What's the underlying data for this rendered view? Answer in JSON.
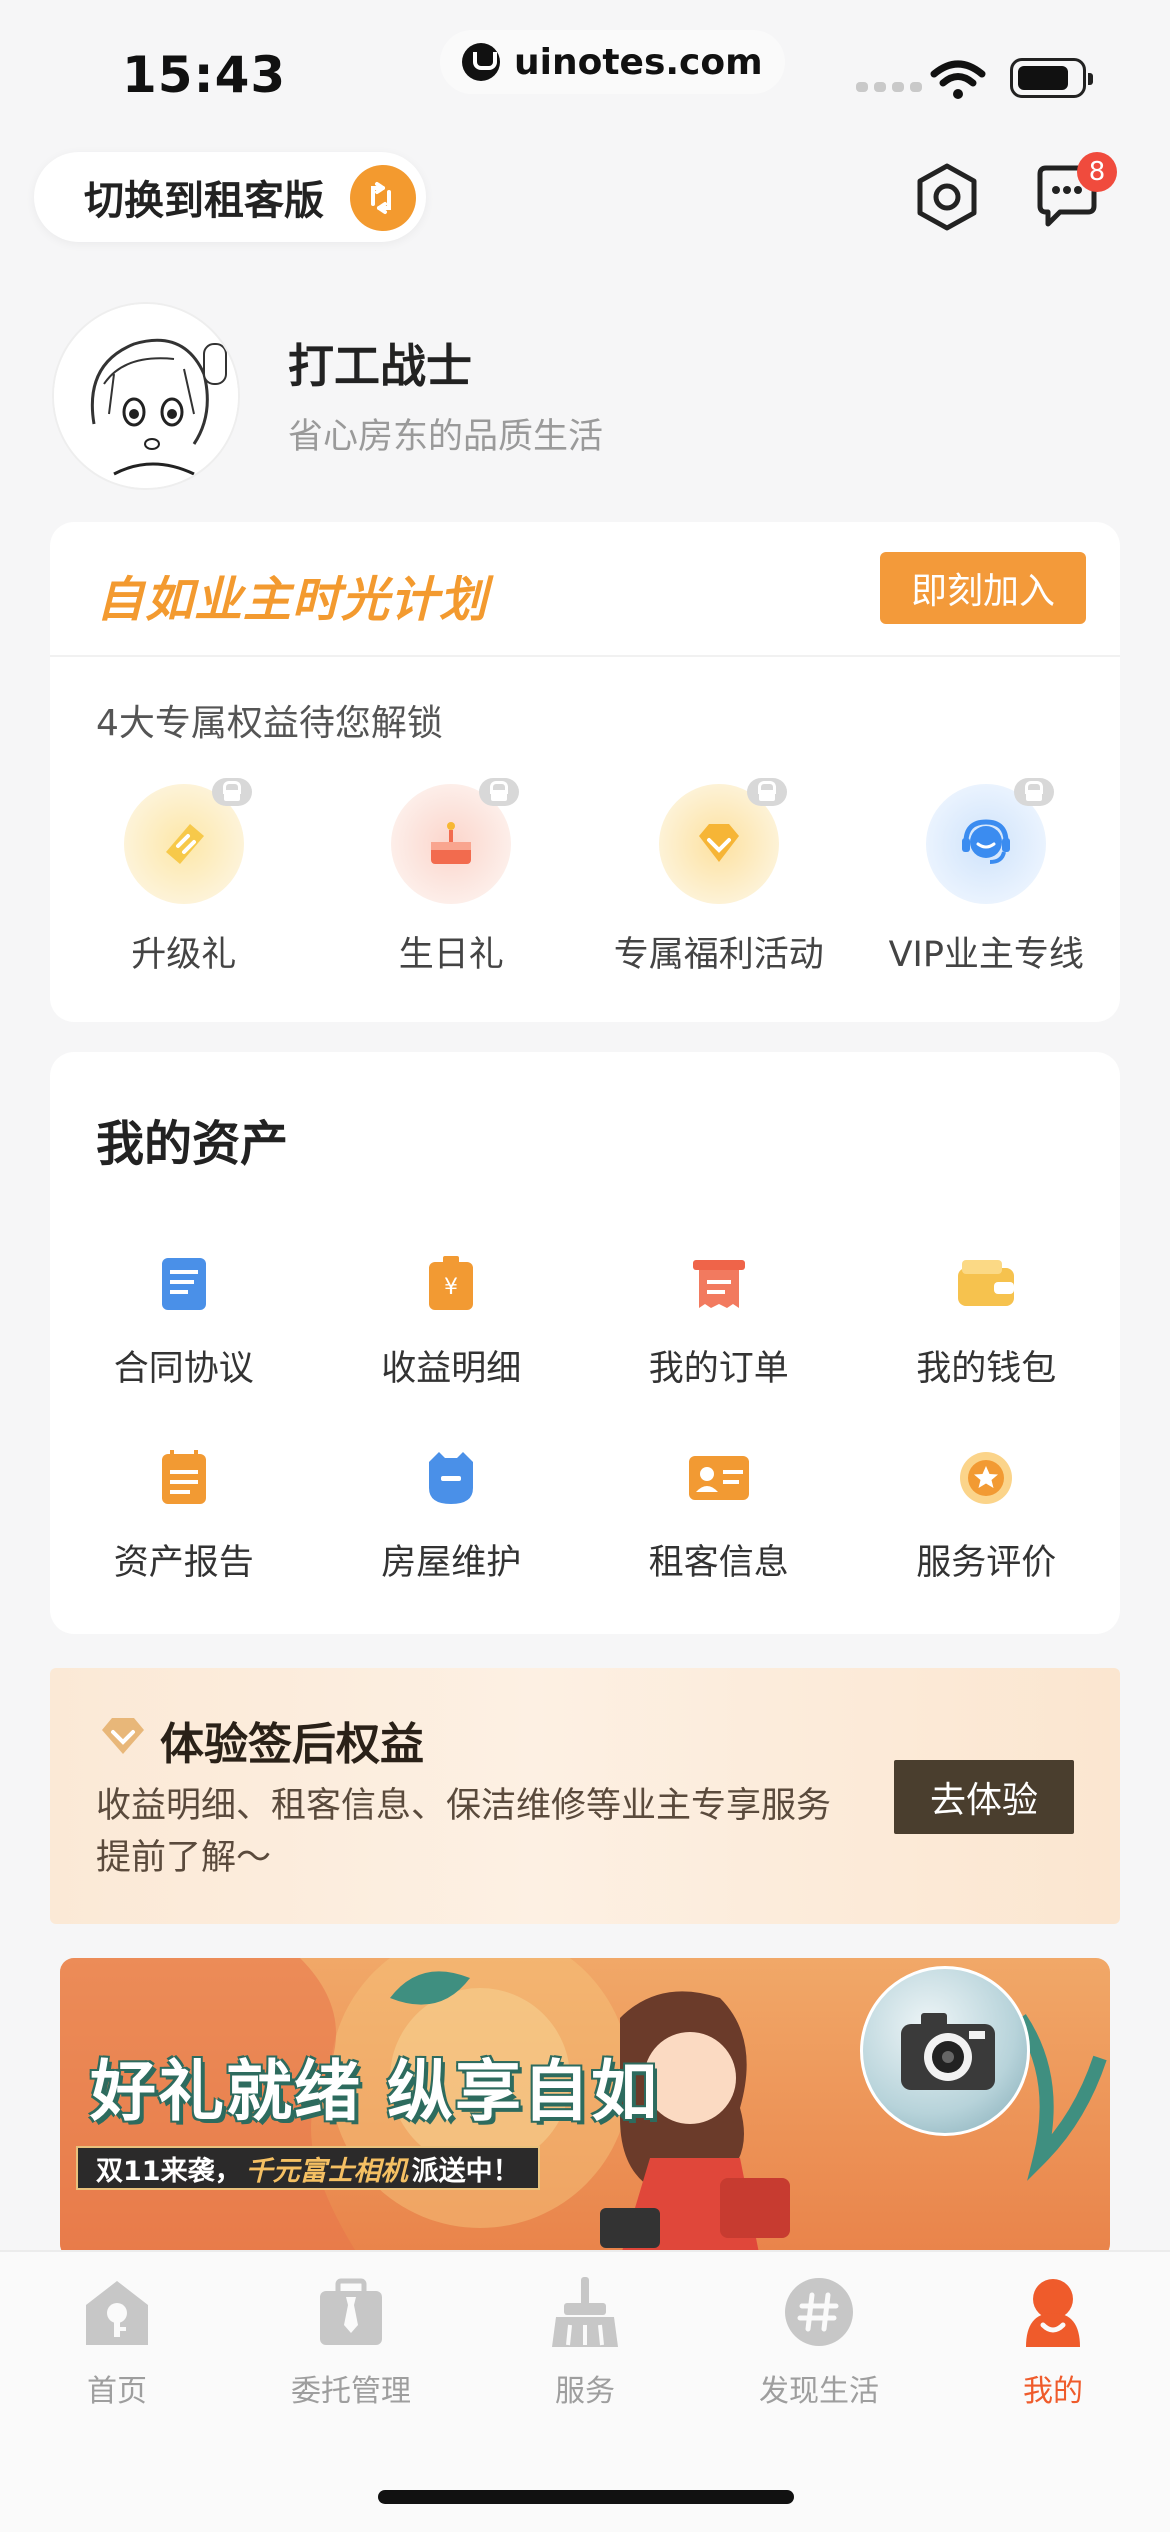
{
  "status": {
    "time": "15:43",
    "url": "uinotes.com"
  },
  "header": {
    "switch_label": "切换到租客版",
    "message_badge": "8"
  },
  "profile": {
    "name": "打工战士",
    "slogan": "省心房东的品质生活"
  },
  "plan": {
    "title": "自如业主时光计划",
    "join_label": "即刻加入",
    "subtitle": "4大专属权益待您解锁",
    "benefits": [
      {
        "label": "升级礼",
        "icon": "ticket-icon"
      },
      {
        "label": "生日礼",
        "icon": "cake-icon"
      },
      {
        "label": "专属福利活动",
        "icon": "diamond-icon"
      },
      {
        "label": "VIP业主专线",
        "icon": "headset-icon"
      }
    ]
  },
  "assets": {
    "title": "我的资产",
    "items": [
      {
        "label": "合同协议",
        "icon": "contract-icon"
      },
      {
        "label": "收益明细",
        "icon": "income-icon"
      },
      {
        "label": "我的订单",
        "icon": "order-icon"
      },
      {
        "label": "我的钱包",
        "icon": "wallet-icon"
      },
      {
        "label": "资产报告",
        "icon": "report-icon"
      },
      {
        "label": "房屋维护",
        "icon": "maintenance-icon"
      },
      {
        "label": "租客信息",
        "icon": "tenant-card-icon"
      },
      {
        "label": "服务评价",
        "icon": "rating-icon"
      }
    ]
  },
  "experience": {
    "title": "体验签后权益",
    "description": "收益明细、租客信息、保洁维修等业主专享服务提前了解～",
    "button": "去体验"
  },
  "promo": {
    "title": "好礼就绪 纵享自如",
    "sub_prefix": "双11来袭，",
    "sub_highlight": "千元富士相机",
    "sub_suffix": "派送中！"
  },
  "tabbar": {
    "tabs": [
      {
        "label": "首页",
        "icon": "home-icon",
        "active": false
      },
      {
        "label": "委托管理",
        "icon": "briefcase-icon",
        "active": false
      },
      {
        "label": "服务",
        "icon": "broom-icon",
        "active": false
      },
      {
        "label": "发现生活",
        "icon": "hashtag-icon",
        "active": false
      },
      {
        "label": "我的",
        "icon": "profile-icon",
        "active": true
      }
    ]
  },
  "colors": {
    "accent": "#f39a2f",
    "active_tab": "#ef5b2b",
    "badge": "#f04b3d",
    "exp_button": "#4a3e2e"
  }
}
